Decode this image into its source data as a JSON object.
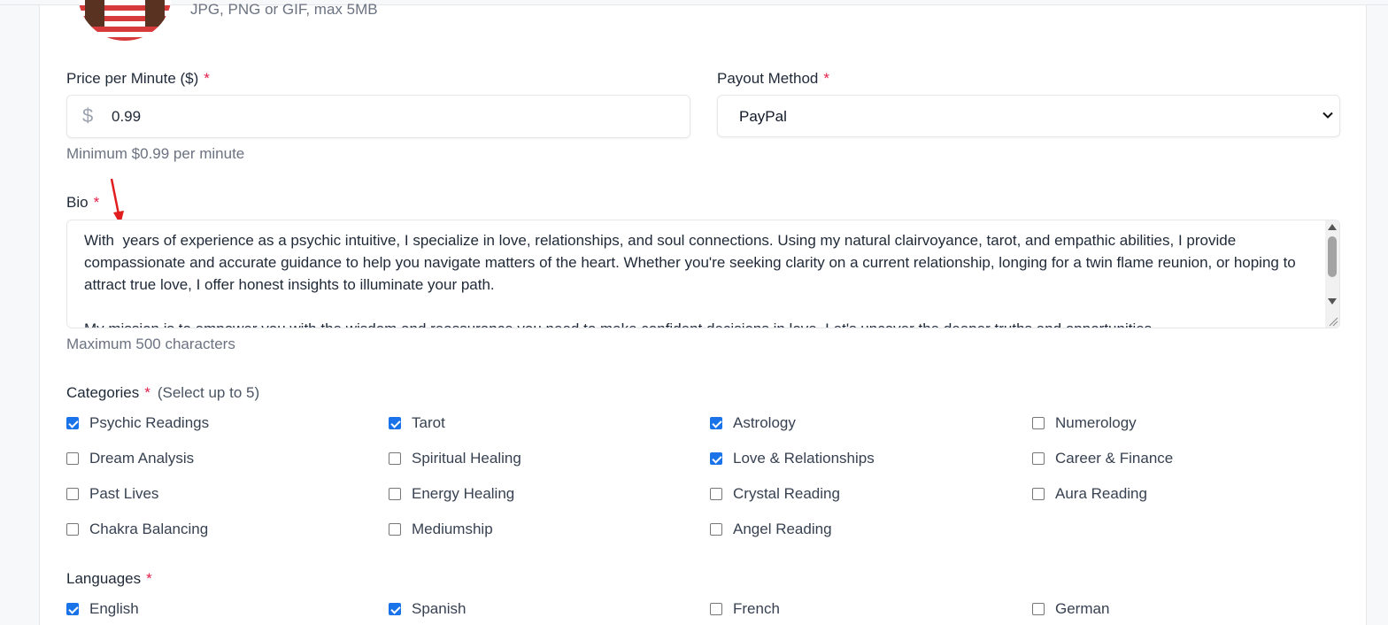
{
  "avatar": {
    "hint": "JPG, PNG or GIF, max 5MB"
  },
  "price": {
    "label": "Price per Minute ($)",
    "required_mark": "*",
    "currency_symbol": "$",
    "value": "0.99",
    "hint": "Minimum $0.99 per minute"
  },
  "payout": {
    "label": "Payout Method",
    "required_mark": "*",
    "selected": "PayPal"
  },
  "bio": {
    "label": "Bio",
    "required_mark": "*",
    "value": "With  years of experience as a psychic intuitive, I specialize in love, relationships, and soul connections. Using my natural clairvoyance, tarot, and empathic abilities, I provide compassionate and accurate guidance to help you navigate matters of the heart. Whether you're seeking clarity on a current relationship, longing for a twin flame reunion, or hoping to attract true love, I offer honest insights to illuminate your path.\n\nMy mission is to empower you with the wisdom and reassurance you need to make confident decisions in love. Let's uncover the deeper truths and opportunities",
    "hint": "Maximum 500 characters"
  },
  "categories": {
    "label": "Categories",
    "required_mark": "*",
    "subtitle": "(Select up to 5)",
    "items": [
      {
        "label": "Psychic Readings",
        "checked": true
      },
      {
        "label": "Tarot",
        "checked": true
      },
      {
        "label": "Astrology",
        "checked": true
      },
      {
        "label": "Numerology",
        "checked": false
      },
      {
        "label": "Dream Analysis",
        "checked": false
      },
      {
        "label": "Spiritual Healing",
        "checked": false
      },
      {
        "label": "Love & Relationships",
        "checked": true
      },
      {
        "label": "Career & Finance",
        "checked": false
      },
      {
        "label": "Past Lives",
        "checked": false
      },
      {
        "label": "Energy Healing",
        "checked": false
      },
      {
        "label": "Crystal Reading",
        "checked": false
      },
      {
        "label": "Aura Reading",
        "checked": false
      },
      {
        "label": "Chakra Balancing",
        "checked": false
      },
      {
        "label": "Mediumship",
        "checked": false
      },
      {
        "label": "Angel Reading",
        "checked": false
      }
    ]
  },
  "languages": {
    "label": "Languages",
    "required_mark": "*",
    "items": [
      {
        "label": "English",
        "checked": true
      },
      {
        "label": "Spanish",
        "checked": true
      },
      {
        "label": "French",
        "checked": false
      },
      {
        "label": "German",
        "checked": false
      }
    ]
  },
  "colors": {
    "accent": "#1a73e8",
    "required": "#e11d48",
    "annotation_arrow": "#e11d1d"
  }
}
